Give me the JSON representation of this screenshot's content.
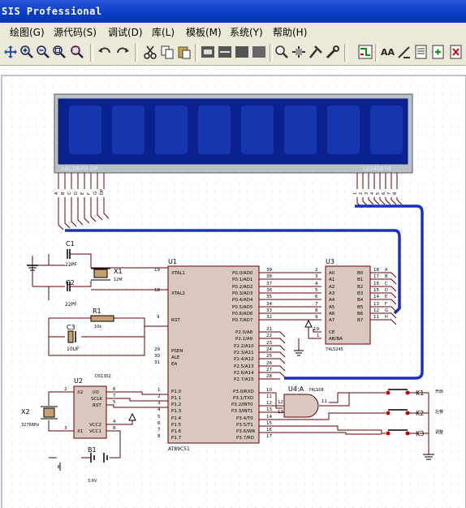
{
  "window": {
    "title": "SIS Professional"
  },
  "menu": [
    {
      "label": "绘图(G)"
    },
    {
      "label": "源代码(S)"
    },
    {
      "label": "调试(D)"
    },
    {
      "label": "库(L)"
    },
    {
      "label": "模板(M)"
    },
    {
      "label": "系统(Y)"
    },
    {
      "label": "帮助(H)"
    }
  ],
  "schematic": {
    "display": {
      "seg_labels": "ABCDEFG DP",
      "digit_labels": "12345678",
      "seg_pins": [
        "A",
        "B",
        "C",
        "D",
        "E",
        "F",
        "G",
        "DP"
      ],
      "digit_pins": [
        "1",
        "2",
        "3",
        "4",
        "5",
        "6",
        "7",
        "8"
      ]
    },
    "crystal1": {
      "ref": "X1",
      "value": "12M"
    },
    "cap1": {
      "ref": "C1",
      "value": "22PF"
    },
    "cap2": {
      "ref": "C2",
      "value": "22PF"
    },
    "cap3": {
      "ref": "C3",
      "value": "10UF"
    },
    "resistor": {
      "ref": "R1",
      "value": "10k"
    },
    "mcu": {
      "ref": "U1",
      "part": "AT89C51",
      "left_pins": [
        {
          "num": "19",
          "name": "XTAL1"
        },
        {
          "num": "18",
          "name": "XTAL2"
        },
        {
          "num": "9",
          "name": "RST"
        },
        {
          "num": "29",
          "name": "PSEN"
        },
        {
          "num": "30",
          "name": "ALE"
        },
        {
          "num": "31",
          "name": "EA"
        },
        {
          "num": "1",
          "name": "P1.0"
        },
        {
          "num": "2",
          "name": "P1.1"
        },
        {
          "num": "3",
          "name": "P1.2"
        },
        {
          "num": "4",
          "name": "P1.3"
        },
        {
          "num": "5",
          "name": "P1.4"
        },
        {
          "num": "6",
          "name": "P1.5"
        },
        {
          "num": "7",
          "name": "P1.6"
        },
        {
          "num": "8",
          "name": "P1.7"
        }
      ],
      "right_pins_p0": [
        {
          "num": "39",
          "name": "P0.0/AD0"
        },
        {
          "num": "38",
          "name": "P0.1/AD1"
        },
        {
          "num": "37",
          "name": "P0.2/AD2"
        },
        {
          "num": "36",
          "name": "P0.3/AD3"
        },
        {
          "num": "35",
          "name": "P0.4/AD4"
        },
        {
          "num": "34",
          "name": "P0.5/AD5"
        },
        {
          "num": "33",
          "name": "P0.6/AD6"
        },
        {
          "num": "32",
          "name": "P0.7/AD7"
        }
      ],
      "right_pins_p2": [
        {
          "num": "21",
          "name": "P2.0/A8"
        },
        {
          "num": "22",
          "name": "P2.1/A9"
        },
        {
          "num": "23",
          "name": "P2.2/A10"
        },
        {
          "num": "24",
          "name": "P2.3/A11"
        },
        {
          "num": "25",
          "name": "P2.4/A12"
        },
        {
          "num": "26",
          "name": "P2.5/A13"
        },
        {
          "num": "27",
          "name": "P2.6/A14"
        },
        {
          "num": "28",
          "name": "P2.7/A15"
        }
      ],
      "right_pins_p3": [
        {
          "num": "10",
          "name": "P3.0/RXD"
        },
        {
          "num": "11",
          "name": "P3.1/TXD"
        },
        {
          "num": "12",
          "name": "P3.2/INT0"
        },
        {
          "num": "13",
          "name": "P3.3/INT1"
        },
        {
          "num": "14",
          "name": "P3.4/T0"
        },
        {
          "num": "15",
          "name": "P3.5/T1"
        },
        {
          "num": "16",
          "name": "P3.6/WR"
        },
        {
          "num": "17",
          "name": "P3.7/RD"
        }
      ]
    },
    "buffer": {
      "ref": "U3",
      "part": "74LS245",
      "left_pins": [
        {
          "num": "2",
          "name": "A0"
        },
        {
          "num": "3",
          "name": "A1"
        },
        {
          "num": "4",
          "name": "A2"
        },
        {
          "num": "5",
          "name": "A3"
        },
        {
          "num": "6",
          "name": "A4"
        },
        {
          "num": "7",
          "name": "A5"
        },
        {
          "num": "8",
          "name": "A6"
        },
        {
          "num": "9",
          "name": "A7"
        }
      ],
      "right_pins": [
        {
          "num": "18",
          "name": "B0"
        },
        {
          "num": "17",
          "name": "B1"
        },
        {
          "num": "16",
          "name": "B2"
        },
        {
          "num": "15",
          "name": "B3"
        },
        {
          "num": "14",
          "name": "B4"
        },
        {
          "num": "13",
          "name": "B5"
        },
        {
          "num": "12",
          "name": "B6"
        },
        {
          "num": "11",
          "name": "B7"
        }
      ],
      "ctrl_pins": [
        {
          "num": "19",
          "name": "CE"
        },
        {
          "num": "1",
          "name": "AB/BA"
        }
      ],
      "right_labels": [
        "A",
        "B",
        "C",
        "D",
        "E",
        "F",
        "G",
        "H"
      ]
    },
    "rtc": {
      "ref": "U2",
      "part": "DS1302",
      "pins": [
        {
          "num": "2",
          "name": "X2"
        },
        {
          "num": "3",
          "name": "X1"
        },
        {
          "num": "6",
          "name": "I/O"
        },
        {
          "num": "7",
          "name": "SCLK"
        },
        {
          "num": "5",
          "name": "RST"
        },
        {
          "num": "4",
          "name": "VCC2"
        },
        {
          "num": "8",
          "name": "VCC1"
        }
      ]
    },
    "crystal2": {
      "ref": "X2",
      "value": "32768Hz"
    },
    "battery": {
      "ref": "B1",
      "value": "3.6V"
    },
    "gate": {
      "ref": "U4:A",
      "part": "74LS08",
      "in_pins": [
        "12",
        "13"
      ],
      "out_pin": "11"
    },
    "keys": [
      {
        "ref": "K1",
        "label": "开启"
      },
      {
        "ref": "K2",
        "label": "左移"
      },
      {
        "ref": "K3",
        "label": "调整"
      }
    ]
  }
}
